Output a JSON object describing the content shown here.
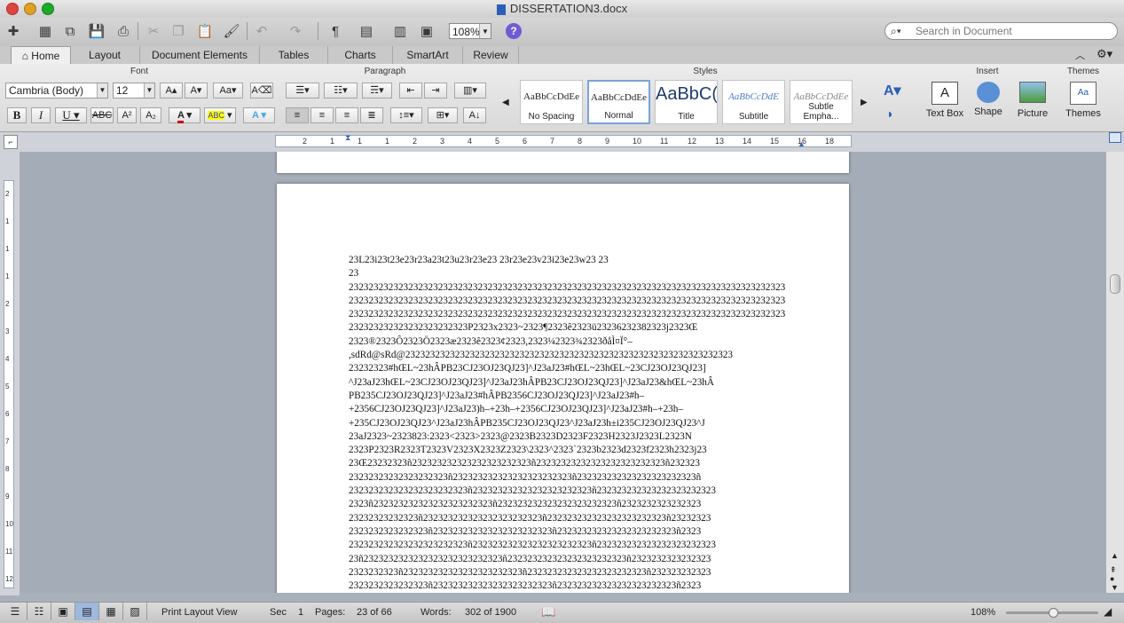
{
  "window": {
    "title": "DISSERTATION3.docx"
  },
  "toolbar": {
    "zoom": "108%"
  },
  "search": {
    "placeholder": "Search in Document"
  },
  "tabs": [
    {
      "label": "Home"
    },
    {
      "label": "Layout"
    },
    {
      "label": "Document Elements"
    },
    {
      "label": "Tables"
    },
    {
      "label": "Charts"
    },
    {
      "label": "SmartArt"
    },
    {
      "label": "Review"
    }
  ],
  "ribbon": {
    "groups": {
      "font": "Font",
      "paragraph": "Paragraph",
      "styles": "Styles",
      "insert": "Insert",
      "themes": "Themes"
    },
    "font_name": "Cambria (Body)",
    "font_size": "12",
    "styles": [
      {
        "preview": "AaBbCcDdEe",
        "label": "No Spacing"
      },
      {
        "preview": "AaBbCcDdEe",
        "label": "Normal"
      },
      {
        "preview": "AaBbC(",
        "label": "Title"
      },
      {
        "preview": "AaBbCcDdE",
        "label": "Subtitle"
      },
      {
        "preview": "AaBbCcDdEe",
        "label": "Subtle Empha..."
      }
    ],
    "insert": [
      {
        "label": "Text Box"
      },
      {
        "label": "Shape"
      },
      {
        "label": "Picture"
      }
    ],
    "themes_label": "Themes"
  },
  "document": {
    "lines": [
      "23L23i23t23e23r23a23t23u23r23e23 23r23e23v23i23e23w23 23",
      "23",
      "2323232323232323232323232323232323232323232323232323232323232323232323232323232323232323",
      "2323232323232323232323232323232323232323232323232323232323232323232323232323232323232323",
      "2323232323232323232323232323232323232323232323232323232323232323232323232323232323232323",
      "232323232323232323232323P2323x2323~2323¶2323ê2323ü23236232382323j2323Œ",
      "2323®2323Ô2323Ö2323æ2323ê2323¢2323,2323¼2323¾2323ðåÌ¤Ï°–",
      ",sdRd@sRd@232323232323232323232323232323232323232323232323232323232323232323",
      "23232323#hŒL~23hÂPB23CJ23OJ23QJ23]^J23aJ23#hŒL~23hŒL~23CJ23OJ23QJ23]",
      "^J23aJ23hŒL~23CJ23OJ23QJ23]^J23aJ23hÂPB23CJ23OJ23QJ23]^J23aJ23&hŒL~23hÂ",
      "PB235CJ23OJ23QJ23]^J23aJ23#hÂPB2356CJ23OJ23QJ23]^J23aJ23#h–",
      "+2356CJ23OJ23QJ23]^J23aJ23)h–+23h–+2356CJ23OJ23QJ23]^J23aJ23#h–+23h–",
      "+235CJ23OJ23QJ23^J23aJ23hÂPB235CJ23OJ23QJ23^J23aJ23h±i235CJ23OJ23QJ23^J",
      "23aJ2323~2323823:2323<2323>2323@2323B2323D2323F2323H2323J2323L2323N",
      "2323P2323R2323T2323V2323X2323Z2323\\2323^2323`2323b2323d2323f2323h2323j23",
      "23Œ23232323ñ232323232323232323232323ñ23232323232323232323232323ñ232323",
      "23232323232323232323ñ232323232323232323232323ñ232323232323232323232323ñ",
      "232323232323232323232323ñ232323232323232323232323ñ232323232323232323232323",
      "2323ñ232323232323232323232323ñ232323232323232323232323ñ2323232323232323",
      "23232323232323ñ232323232323232323232323ñ232323232323232323232323ñ23232323",
      "2323232323232323ñ232323232323232323232323ñ232323232323232323232323ñ2323",
      "232323232323232323232323ñ232323232323232323232323ñ232323232323232323232323",
      "23ñ2323232323232323232323232323ñ232323232323232323232323ñ2323232323232323",
      "2323232323ñ232323232323232323232323ñ232323232323232323232323ñ232323232323",
      "2323232323232323ñ232323232323232323232323ñ232323232323232323232323ñ2323"
    ]
  },
  "status": {
    "view": "Print Layout View",
    "sec_label": "Sec",
    "sec_value": "1",
    "pages_label": "Pages:",
    "pages_value": "23 of 66",
    "words_label": "Words:",
    "words_value": "302 of 1900",
    "zoom": "108%"
  },
  "ruler": {
    "h_numbers": [
      "2",
      "1",
      "1",
      "1",
      "2",
      "3",
      "4",
      "5",
      "6",
      "7",
      "8",
      "9",
      "10",
      "11",
      "12",
      "13",
      "14",
      "15",
      "16",
      "18"
    ],
    "v_numbers": [
      "2",
      "1",
      "1",
      "1",
      "2",
      "3",
      "4",
      "5",
      "6",
      "7",
      "8",
      "9",
      "10",
      "11",
      "12"
    ]
  }
}
